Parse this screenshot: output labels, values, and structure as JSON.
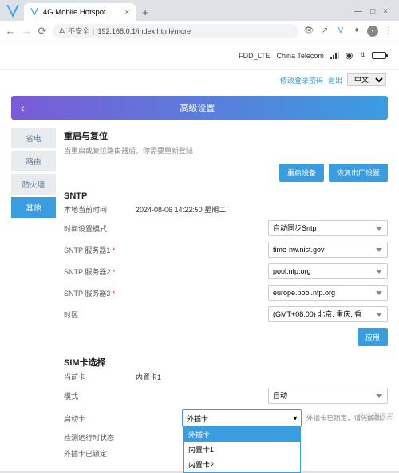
{
  "browser": {
    "tab_title": "4G Mobile Hotspot",
    "url_warning": "不安全",
    "url": "192.168.0.1/index.html#more",
    "win": {
      "min": "—",
      "max": "□",
      "close": "×"
    }
  },
  "status": {
    "mode": "FDD_LTE",
    "carrier": "China Telecom",
    "change_pwd": "修改登录密码",
    "logout": "退出",
    "lang": "中文"
  },
  "header": {
    "title": "高级设置"
  },
  "sidebar": [
    "省电",
    "路由",
    "防火墙",
    "其他"
  ],
  "sidebar_active": 3,
  "reboot": {
    "title": "重启与复位",
    "sub": "当重启或复位路由器后，你需要重新登陆",
    "btn1": "重启设备",
    "btn2": "恢复出厂设置"
  },
  "sntp": {
    "title": "SNTP",
    "local_time_lbl": "本地当前时间",
    "local_time_val": "2024-08-06 14:22:50   星期二",
    "mode_lbl": "时间设置模式",
    "mode_val": "自动同步Sntp",
    "srv1_lbl": "SNTP 服务器1",
    "srv1_val": "time-nw.nist.gov",
    "srv2_lbl": "SNTP 服务器2",
    "srv2_val": "pool.ntp.org",
    "srv3_lbl": "SNTP 服务器3",
    "srv3_val": "europe.pool.ntp.org",
    "tz_lbl": "时区",
    "tz_val": "(GMT+08:00) 北京, 重庆, 香",
    "apply": "应用",
    "star": " *"
  },
  "sim": {
    "title": "SIM卡选择",
    "cur_lbl": "当前卡",
    "cur_val": "内置卡1",
    "mode_lbl": "模式",
    "mode_val": "自动",
    "boot_lbl": "启动卡",
    "boot_sel": "外插卡",
    "boot_note": "外插卡已锁定，请先解锁。",
    "opts": [
      "外插卡",
      "内置卡1",
      "内置卡2"
    ],
    "det_lbl": "检测运行时状态",
    "ext_lbl": "外插卡已锁定"
  },
  "watermark": "什么值得买"
}
